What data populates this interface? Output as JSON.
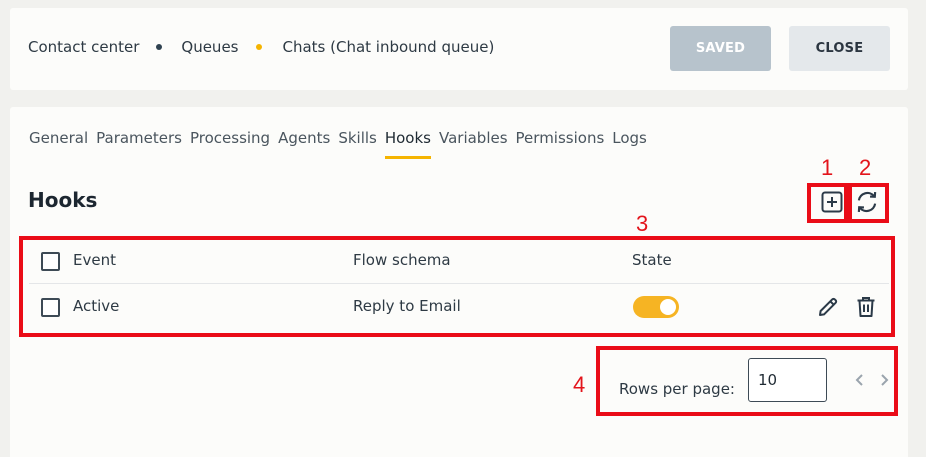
{
  "breadcrumb": {
    "items": [
      "Contact center",
      "Queues",
      "Chats (Chat inbound queue)"
    ],
    "dot_colors": [
      "#2f4250",
      "#f5b400"
    ]
  },
  "actions": {
    "saved_label": "SAVED",
    "close_label": "CLOSE"
  },
  "tabs": [
    {
      "label": "General"
    },
    {
      "label": "Parameters"
    },
    {
      "label": "Processing"
    },
    {
      "label": "Agents"
    },
    {
      "label": "Skills"
    },
    {
      "label": "Hooks"
    },
    {
      "label": "Variables"
    },
    {
      "label": "Permissions"
    },
    {
      "label": "Logs"
    }
  ],
  "active_tab": "Hooks",
  "section": {
    "title": "Hooks"
  },
  "toolbar_icons": [
    "add-box-icon",
    "refresh-icon"
  ],
  "table": {
    "columns": [
      "Event",
      "Flow schema",
      "State"
    ],
    "rows": [
      {
        "event": "Active",
        "flow_schema": "Reply to Email",
        "state": "on"
      }
    ]
  },
  "pagination": {
    "rows_label": "Rows per page:",
    "rows_value": "10"
  },
  "annotations": [
    "1",
    "2",
    "3",
    "4"
  ],
  "colors": {
    "accent": "#f5b400",
    "annotation": "#ea0c17",
    "toggle_on": "#f6b423"
  }
}
